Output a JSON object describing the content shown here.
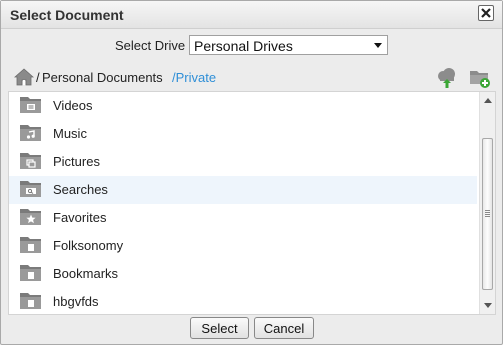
{
  "dialog": {
    "title": "Select Document",
    "close_icon": "close-icon"
  },
  "drive": {
    "label": "Select Drive",
    "selected": "Personal Drives"
  },
  "path": {
    "separator": "/",
    "parent": "Personal Documents",
    "current": "/Private",
    "home_icon": "home-icon",
    "upload_icon": "cloud-upload-icon",
    "new_folder_icon": "new-folder-icon"
  },
  "folders": [
    {
      "label": "Videos",
      "icon": "video-folder-icon"
    },
    {
      "label": "Music",
      "icon": "music-folder-icon"
    },
    {
      "label": "Pictures",
      "icon": "pictures-folder-icon"
    },
    {
      "label": "Searches",
      "icon": "search-folder-icon"
    },
    {
      "label": "Favorites",
      "icon": "favorites-folder-icon"
    },
    {
      "label": "Folksonomy",
      "icon": "folder-icon"
    },
    {
      "label": "Bookmarks",
      "icon": "folder-icon"
    },
    {
      "label": "hbgvfds",
      "icon": "folder-icon"
    }
  ],
  "buttons": {
    "select": "Select",
    "cancel": "Cancel"
  },
  "colors": {
    "link": "#2f8fd7",
    "highlight_row": "#eef5fc"
  }
}
